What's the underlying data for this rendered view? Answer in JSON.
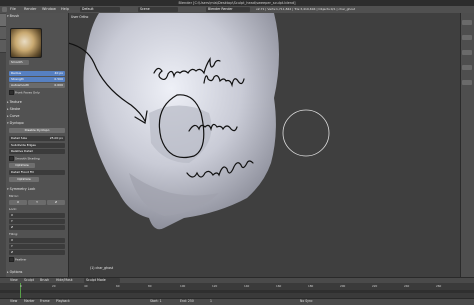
{
  "window": {
    "title": "Blender [C:\\Users\\mia\\Desktop\\Sculpt_head\\sweeper_sculpt.blend]"
  },
  "menu": {
    "items": [
      "File",
      "Render",
      "Window",
      "Help"
    ],
    "layout": "Default",
    "scene": "Scene",
    "engine": "Blender Render",
    "stats": "v2.71 | Verts:1,711,842 | Tris:3,419,694 | Objects:0/1 | char_ghost"
  },
  "toolshelf": {
    "brush_header": "Brush",
    "brush_name": "Smooth",
    "radius_label": "Radius",
    "radius_value": "40 px",
    "strength_label": "Strength",
    "strength_value": "0.500",
    "autosmooth_label": "Autosmooth",
    "autosmooth_value": "0.000",
    "front_faces": "Front Faces Only",
    "panels": [
      "Texture",
      "Stroke",
      "Curve",
      "Dyntopo"
    ],
    "dyntopo_button": "Disable Dyntopo",
    "detail_size_label": "Detail Size",
    "detail_size_value": "25.00 px",
    "subdivide": "Subdivide Edges",
    "relative": "Relative Detail",
    "smooth_shading": "Smooth Shading",
    "optimize": "Optimize",
    "detail_flood": "Detail Flood Fill",
    "symmetry_header": "Symmetry Lock",
    "mirror_label": "Mirror:",
    "mirror_axes": [
      "X",
      "Y",
      "Z"
    ],
    "lock_label": "Lock:",
    "lock_axes": [
      "X",
      "Y",
      "Z"
    ],
    "tiling_label": "Tiling:",
    "tiling_axes": [
      "X",
      "Y",
      "Z"
    ],
    "feather_label": "Feather",
    "options_label": "Options"
  },
  "viewport": {
    "label": "User Ortho",
    "object_label": "(1) char_ghost"
  },
  "footer": {
    "view_header": [
      "View",
      "Sculpt",
      "Brush",
      "Hide/Mask"
    ],
    "mode": "Sculpt Mode",
    "timeline": [
      "View",
      "Marker",
      "Frame",
      "Playback"
    ],
    "start": "Start: 1",
    "end": "End: 250",
    "frame": "1",
    "sync": "No Sync"
  },
  "ticks": [
    "0",
    "20",
    "40",
    "60",
    "80",
    "100",
    "120",
    "140",
    "160",
    "180",
    "200",
    "220",
    "240",
    "260"
  ]
}
